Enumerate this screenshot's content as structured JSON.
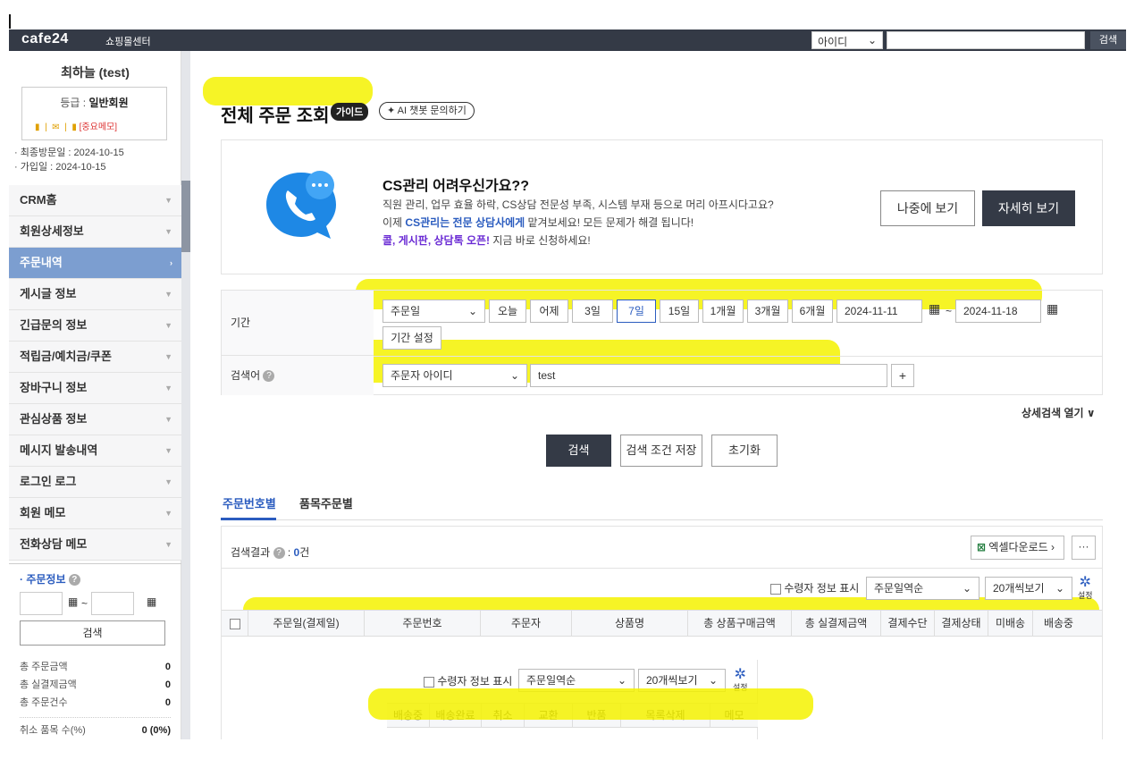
{
  "header": {
    "logo": "cafe24",
    "logo_sub": "쇼핑몰센터",
    "search_type": "아이디",
    "search_button": "검색"
  },
  "sidebar": {
    "user_name": "최하늘 (test)",
    "grade_label": "등급 :",
    "grade_value": "일반회원",
    "memo_label": "[중요메모]",
    "last_visit": "· 최종방문일 : 2024-10-15",
    "join_date": "· 가입일 : 2024-10-15",
    "menu": [
      {
        "label": "CRM홈"
      },
      {
        "label": "회원상세정보"
      },
      {
        "label": "주문내역"
      },
      {
        "label": "게시글 정보"
      },
      {
        "label": "긴급문의 정보"
      },
      {
        "label": "적립금/예치금/쿠폰"
      },
      {
        "label": "장바구니 정보"
      },
      {
        "label": "관심상품 정보"
      },
      {
        "label": "메시지 발송내역"
      },
      {
        "label": "로그인 로그"
      },
      {
        "label": "회원 메모"
      },
      {
        "label": "전화상담 메모"
      }
    ],
    "order_info_title": "· 주문정보",
    "date_sep": "~",
    "search_button": "검색",
    "stats": [
      {
        "label": "총 주문금액",
        "value": "0"
      },
      {
        "label": "총 실결제금액",
        "value": "0"
      },
      {
        "label": "총 주문건수",
        "value": "0"
      }
    ],
    "cancel_label": "취소 품목 수(%)",
    "cancel_value": "0 (0%)"
  },
  "page": {
    "title": "전체 주문 조회",
    "guide_badge": "가이드",
    "ai_button": "✦ AI 챗봇 문의하기"
  },
  "banner": {
    "title": "CS관리 어려우신가요??",
    "line1": "직원 관리, 업무 효율 하락, CS상담 전문성 부족, 시스템 부재 등으로 머리 아프시다고요?",
    "line2_pre": "이제 ",
    "line2_hl": "CS관리는 전문 상담사에게",
    "line2_post": " 맡겨보세요! 모든 문제가 해결 됩니다!",
    "line3_hl": "콜, 게시판, 상담톡 오픈!",
    "line3_post": " 지금 바로 신청하세요!",
    "later_button": "나중에 보기",
    "detail_button": "자세히 보기"
  },
  "filter": {
    "period_label": "기간",
    "date_type": "주문일",
    "quick_buttons": [
      "오늘",
      "어제",
      "3일",
      "7일",
      "15일",
      "1개월",
      "3개월",
      "6개월"
    ],
    "active_quick": "7일",
    "start_date": "2024-11-11",
    "end_date": "2024-11-18",
    "date_sep": "~",
    "period_setting": "기간 설정",
    "keyword_label": "검색어",
    "keyword_type": "주문자 아이디",
    "keyword_value": "test",
    "add_button": "+",
    "detail_search": "상세검색 열기 ∨"
  },
  "actions": {
    "search": "검색",
    "save_condition": "검색 조건 저장",
    "reset": "초기화"
  },
  "tabs": [
    "주문번호별",
    "품목주문별"
  ],
  "results": {
    "label": "검색결과",
    "count": "0",
    "unit": "건",
    "excel_button": "엑셀다운로드 ›",
    "more_button": "···",
    "show_receiver": "수령자 정보 표시",
    "sort": "주문일역순",
    "page_size": "20개씩보기",
    "settings": "설정",
    "columns": [
      "주문일(결제일)",
      "주문번호",
      "주문자",
      "상품명",
      "총 상품구매금액",
      "총 실결제금액",
      "결제수단",
      "결제상태",
      "미배송",
      "배송중"
    ]
  },
  "overlay": {
    "show_receiver": "수령자 정보 표시",
    "sort": "주문일역순",
    "page_size": "20개씩보기",
    "settings": "설정",
    "columns": [
      "배송중",
      "배송완료",
      "취소",
      "교환",
      "반품",
      "목록삭제",
      "메모"
    ]
  },
  "colors": {
    "accent": "#2b5cbf",
    "highlight": "#f5f200",
    "dark": "#343a46"
  }
}
